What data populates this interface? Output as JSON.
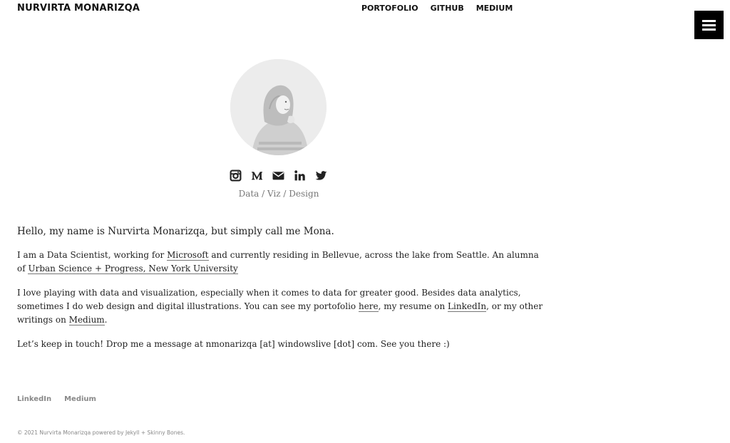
{
  "header": {
    "site_title": "NURVIRTA MONARIZQA",
    "nav": [
      "PORTOFOLIO",
      "GITHUB",
      "MEDIUM"
    ],
    "menu_icon": "hamburger-icon"
  },
  "profile": {
    "avatar_icon": "profile-photo",
    "social_icons": [
      "instagram-icon",
      "medium-icon",
      "email-icon",
      "linkedin-icon",
      "twitter-icon"
    ],
    "tagline": "Data / Viz / Design"
  },
  "content": {
    "intro": "Hello, my name is Nurvirta Monarizqa, but simply call me Mona.",
    "p1": {
      "t1": "I am a Data Scientist, working for ",
      "link_microsoft": "Microsoft",
      "t2": " and currently residing in Bellevue, across the lake from Seattle. An alumna of ",
      "link_school": "Urban Science + Progress, New York University"
    },
    "p2": {
      "t1": "I love playing with data and visualization, especially when it comes to data for greater good. Besides data analytics, sometimes I do web design and digital illustrations. You can see my portofolio ",
      "link_here": "here",
      "t2": ", my resume on ",
      "link_linkedin": "LinkedIn",
      "t3": ", or my other writings on ",
      "link_medium": "Medium",
      "t4": "."
    },
    "p3": "Let’s keep in touch! Drop me a message at nmonarizqa [at] windowslive [dot] com. See you there :)"
  },
  "footer": {
    "links": [
      "LinkedIn",
      "Medium"
    ],
    "copyright": "© 2021 Nurvirta Monarizqa powered by Jekyll + Skinny Bones."
  }
}
